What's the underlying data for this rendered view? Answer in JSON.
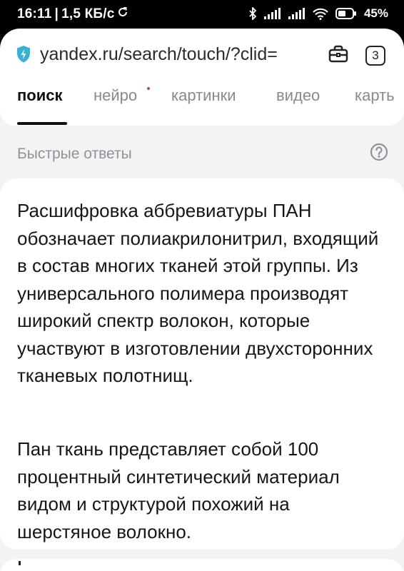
{
  "status_bar": {
    "time": "16:11",
    "separator": "|",
    "network_speed": "1,5 КБ/с",
    "battery_percent": "45%",
    "icons": [
      "sync-icon",
      "bluetooth-icon",
      "signal-icon",
      "signal-icon",
      "wifi-icon",
      "battery-icon"
    ]
  },
  "browser": {
    "url": "yandex.ru/search/touch/?clid=",
    "tabs_count": "3",
    "icons": [
      "shield-icon",
      "briefcase-icon"
    ]
  },
  "search_tabs": [
    {
      "label": "поиск",
      "active": true
    },
    {
      "label": "нейро",
      "active": false
    },
    {
      "label": "картинки",
      "active": false
    },
    {
      "label": "видео",
      "active": false
    },
    {
      "label": "карть",
      "active": false
    }
  ],
  "quick_answers": {
    "title": "Быстрые ответы",
    "paragraphs": [
      "Расшифровка аббревиатуры ПАН обозначает полиакрилонитрил, входящий в состав многих тканей этой группы. Из универсального полимера производят широкий спектр волокон, которые участвуют в изготовлении двухсторонних тканевых полотнищ.",
      "Пан ткань представляет собой 100 процентный синтетический материал видом и структурой похожий на шерстяное волокно."
    ]
  },
  "colors": {
    "accent_shield": "#3bb0d6",
    "text_primary": "#161616",
    "text_muted": "#8f9296",
    "background": "#f2f3f5"
  }
}
